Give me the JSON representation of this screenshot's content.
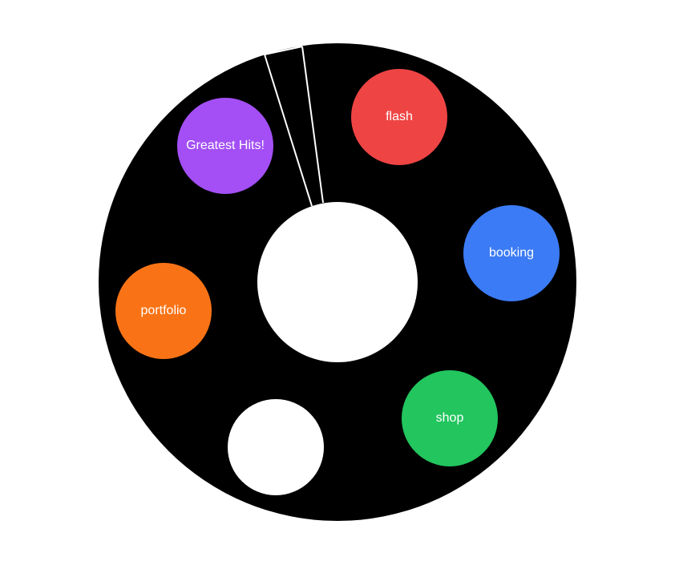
{
  "colors": {
    "wheel_background": "#000000",
    "center_hub": "#ffffff",
    "divider_line": "#ffffff"
  },
  "menu": {
    "items": [
      {
        "key": "flash",
        "label": "flash",
        "color": "#ef4444"
      },
      {
        "key": "booking",
        "label": "booking",
        "color": "#3b7bf5"
      },
      {
        "key": "shop",
        "label": "shop",
        "color": "#22c55e"
      },
      {
        "key": "empty",
        "label": "",
        "color": "#ffffff"
      },
      {
        "key": "portfolio",
        "label": "portfolio",
        "color": "#f97316"
      },
      {
        "key": "greatest",
        "label": "Greatest Hits!",
        "color": "#a34ff5"
      }
    ]
  }
}
